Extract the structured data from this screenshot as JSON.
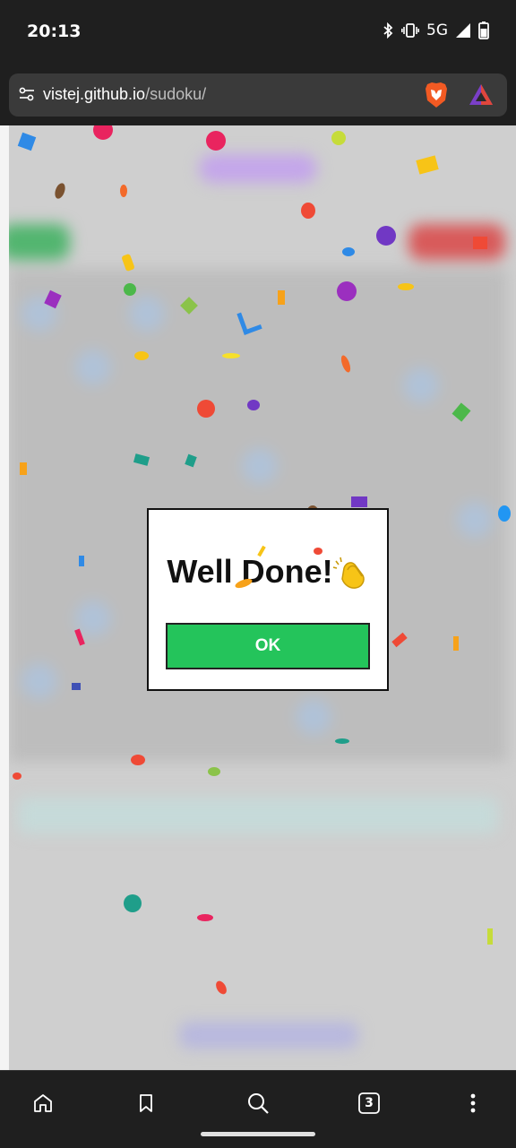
{
  "status_bar": {
    "time": "20:13",
    "network": "5G"
  },
  "url_bar": {
    "host": "vistej.github.io",
    "path": "/sudoku/"
  },
  "dialog": {
    "title": "Well Done!",
    "ok_label": "OK"
  },
  "bottom_nav": {
    "tabs_count": "3"
  },
  "icons": {
    "status": [
      "bluetooth-icon",
      "vibrate-icon",
      "signal-icon",
      "battery-icon"
    ],
    "url": [
      "tune-icon",
      "brave-shield-icon",
      "brave-rewards-icon"
    ],
    "nav": [
      "home-icon",
      "bookmark-icon",
      "search-icon",
      "tabs-icon",
      "more-icon"
    ],
    "dialog": [
      "clapping-hands-icon"
    ]
  },
  "colors": {
    "ok_button": "#24c45b",
    "chrome_bg": "#1f1f1f",
    "url_bar_bg": "#3a3a3a"
  }
}
